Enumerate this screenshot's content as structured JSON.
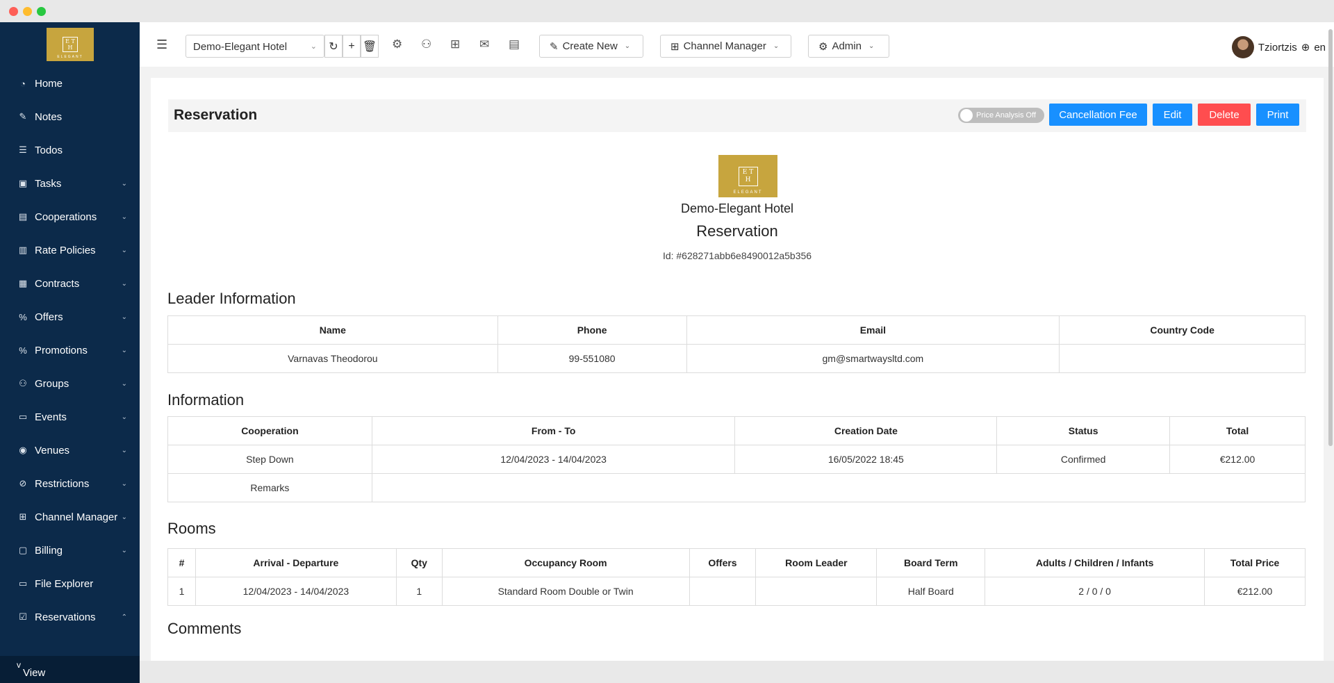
{
  "sidebar": {
    "logo": {
      "mark_top": "E T",
      "mark_bottom": "H",
      "sub": "ELEGANT"
    },
    "items": [
      {
        "label": "Home",
        "icon": "dashboard-icon",
        "glyph": "◔",
        "chevron": ""
      },
      {
        "label": "Notes",
        "icon": "edit-icon",
        "glyph": "✎",
        "chevron": ""
      },
      {
        "label": "Todos",
        "icon": "list-icon",
        "glyph": "☰",
        "chevron": ""
      },
      {
        "label": "Tasks",
        "icon": "task-icon",
        "glyph": "▣",
        "chevron": "⌄"
      },
      {
        "label": "Cooperations",
        "icon": "cooperation-icon",
        "glyph": "▤",
        "chevron": "⌄"
      },
      {
        "label": "Rate Policies",
        "icon": "policy-icon",
        "glyph": "▥",
        "chevron": "⌄"
      },
      {
        "label": "Contracts",
        "icon": "contract-icon",
        "glyph": "▦",
        "chevron": "⌄"
      },
      {
        "label": "Offers",
        "icon": "percent-icon",
        "glyph": "%",
        "chevron": "⌄"
      },
      {
        "label": "Promotions",
        "icon": "percent-icon",
        "glyph": "%",
        "chevron": "⌄"
      },
      {
        "label": "Groups",
        "icon": "group-icon",
        "glyph": "⚇",
        "chevron": "⌄"
      },
      {
        "label": "Events",
        "icon": "calendar-icon",
        "glyph": "▭",
        "chevron": "⌄"
      },
      {
        "label": "Venues",
        "icon": "location-icon",
        "glyph": "◉",
        "chevron": "⌄"
      },
      {
        "label": "Restrictions",
        "icon": "stop-icon",
        "glyph": "⊘",
        "chevron": "⌄"
      },
      {
        "label": "Channel Manager",
        "icon": "channel-icon",
        "glyph": "⊞",
        "chevron": "⌄"
      },
      {
        "label": "Billing",
        "icon": "wallet-icon",
        "glyph": "▢",
        "chevron": "⌄"
      },
      {
        "label": "File Explorer",
        "icon": "folder-icon",
        "glyph": "▭",
        "chevron": ""
      },
      {
        "label": "Reservations",
        "icon": "check-icon",
        "glyph": "☑",
        "chevron": "⌃"
      }
    ],
    "sub_item": {
      "prefix": "v",
      "label": "View"
    }
  },
  "topbar": {
    "hotel": "Demo-Elegant Hotel",
    "create_new": "Create New",
    "channel_manager": "Channel Manager",
    "admin": "Admin",
    "user": "Tziortzis",
    "lang": "en"
  },
  "header": {
    "title": "Reservation",
    "toggle": "Price Analysis Off",
    "buttons": {
      "cancellation_fee": "Cancellation Fee",
      "edit": "Edit",
      "delete": "Delete",
      "print": "Print"
    }
  },
  "doc": {
    "hotel": "Demo-Elegant Hotel",
    "title": "Reservation",
    "id": "Id: #628271abb6e8490012a5b356"
  },
  "leader": {
    "title": "Leader Information",
    "headers": [
      "Name",
      "Phone",
      "Email",
      "Country Code"
    ],
    "row": [
      "Varnavas Theodorou",
      "99-551080",
      "gm@smartwaysltd.com",
      ""
    ]
  },
  "information": {
    "title": "Information",
    "headers": [
      "Cooperation",
      "From - To",
      "Creation Date",
      "Status",
      "Total"
    ],
    "row": [
      "Step Down",
      "12/04/2023 - 14/04/2023",
      "16/05/2022 18:45",
      "Confirmed",
      "€212.00"
    ],
    "remarks_label": "Remarks",
    "remarks_value": ""
  },
  "rooms": {
    "title": "Rooms",
    "headers": [
      "#",
      "Arrival - Departure",
      "Qty",
      "Occupancy Room",
      "Offers",
      "Room Leader",
      "Board Term",
      "Adults / Children / Infants",
      "Total Price"
    ],
    "row": [
      "1",
      "12/04/2023 - 14/04/2023",
      "1",
      "Standard Room Double or Twin",
      "",
      "",
      "Half Board",
      "2 / 0 / 0",
      "€212.00"
    ]
  },
  "comments": {
    "title": "Comments"
  }
}
